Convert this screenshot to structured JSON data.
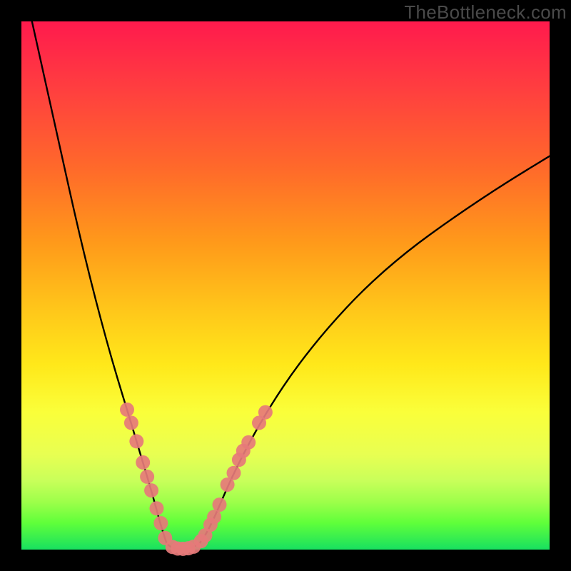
{
  "watermark": "TheBottleneck.com",
  "chart_data": {
    "type": "line",
    "title": "",
    "xlabel": "",
    "ylabel": "",
    "xlim": [
      0,
      100
    ],
    "ylim": [
      0,
      100
    ],
    "series": [
      {
        "name": "left-curve",
        "x": [
          2,
          4,
          6,
          8,
          10,
          12,
          14,
          16,
          18,
          20,
          21.5,
          23,
          24.2,
          25.2,
          26,
          26.8,
          27.5
        ],
        "y": [
          100,
          91,
          82,
          73,
          64,
          55.5,
          47.5,
          40,
          33,
          26.5,
          21.5,
          16.5,
          12.5,
          9,
          6,
          3.3,
          1.2
        ]
      },
      {
        "name": "trough",
        "x": [
          27.5,
          28.2,
          29,
          30,
          31,
          32,
          33,
          33.8
        ],
        "y": [
          1.2,
          0.5,
          0.2,
          0.1,
          0.15,
          0.35,
          0.7,
          1.3
        ]
      },
      {
        "name": "right-curve",
        "x": [
          33.8,
          35,
          36.5,
          38,
          40,
          43,
          47,
          52,
          58,
          65,
          73,
          82,
          91,
          100
        ],
        "y": [
          1.3,
          3,
          6,
          9.5,
          14,
          20,
          27,
          34.5,
          42,
          49.5,
          56.5,
          63,
          69,
          74.5
        ]
      }
    ],
    "markers": {
      "name": "beads",
      "color": "#e67a7a",
      "radius_pct": 1.35,
      "points": [
        {
          "x": 20.0,
          "y": 26.5
        },
        {
          "x": 20.8,
          "y": 24.0
        },
        {
          "x": 21.8,
          "y": 20.5
        },
        {
          "x": 23.0,
          "y": 16.5
        },
        {
          "x": 23.8,
          "y": 13.8
        },
        {
          "x": 24.6,
          "y": 11.2
        },
        {
          "x": 25.6,
          "y": 7.8
        },
        {
          "x": 26.4,
          "y": 5.0
        },
        {
          "x": 27.2,
          "y": 2.2
        },
        {
          "x": 28.6,
          "y": 0.5
        },
        {
          "x": 29.6,
          "y": 0.2
        },
        {
          "x": 30.6,
          "y": 0.15
        },
        {
          "x": 31.6,
          "y": 0.25
        },
        {
          "x": 32.6,
          "y": 0.55
        },
        {
          "x": 34.0,
          "y": 1.6
        },
        {
          "x": 34.8,
          "y": 2.7
        },
        {
          "x": 35.8,
          "y": 4.7
        },
        {
          "x": 36.5,
          "y": 6.2
        },
        {
          "x": 37.5,
          "y": 8.5
        },
        {
          "x": 39.0,
          "y": 12.3
        },
        {
          "x": 40.2,
          "y": 14.5
        },
        {
          "x": 41.2,
          "y": 17.0
        },
        {
          "x": 42.0,
          "y": 18.7
        },
        {
          "x": 43.0,
          "y": 20.3
        },
        {
          "x": 45.0,
          "y": 24.0
        },
        {
          "x": 46.2,
          "y": 26.0
        }
      ]
    }
  }
}
